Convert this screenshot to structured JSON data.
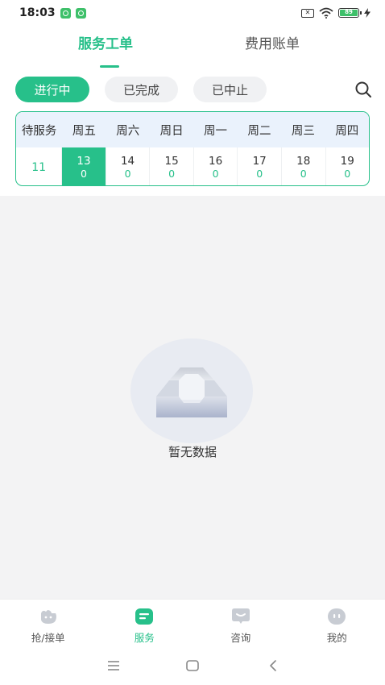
{
  "status_bar": {
    "time": "18:03",
    "battery": "89"
  },
  "top_tabs": [
    {
      "label": "服务工单",
      "active": true
    },
    {
      "label": "费用账单",
      "active": false
    }
  ],
  "filters": [
    {
      "label": "进行中",
      "active": true
    },
    {
      "label": "已完成",
      "active": false
    },
    {
      "label": "已中止",
      "active": false
    }
  ],
  "calendar": {
    "pending_label": "待服务",
    "pending_count": "11",
    "days": [
      {
        "weekday": "周五",
        "date": "13",
        "count": "0",
        "selected": true
      },
      {
        "weekday": "周六",
        "date": "14",
        "count": "0",
        "selected": false
      },
      {
        "weekday": "周日",
        "date": "15",
        "count": "0",
        "selected": false
      },
      {
        "weekday": "周一",
        "date": "16",
        "count": "0",
        "selected": false
      },
      {
        "weekday": "周二",
        "date": "17",
        "count": "0",
        "selected": false
      },
      {
        "weekday": "周三",
        "date": "18",
        "count": "0",
        "selected": false
      },
      {
        "weekday": "周四",
        "date": "19",
        "count": "0",
        "selected": false
      }
    ]
  },
  "empty_state": {
    "text": "暂无数据",
    "icon": "empty-box-icon"
  },
  "bottom_nav": [
    {
      "label": "抢/接单",
      "icon": "grab-order-icon",
      "active": false
    },
    {
      "label": "服务",
      "icon": "service-icon",
      "active": true
    },
    {
      "label": "咨询",
      "icon": "chat-icon",
      "active": false
    },
    {
      "label": "我的",
      "icon": "profile-icon",
      "active": false
    }
  ],
  "colors": {
    "accent": "#27c08a",
    "calendar_header_bg": "#eaf2fc",
    "content_bg": "#f3f3f4"
  }
}
